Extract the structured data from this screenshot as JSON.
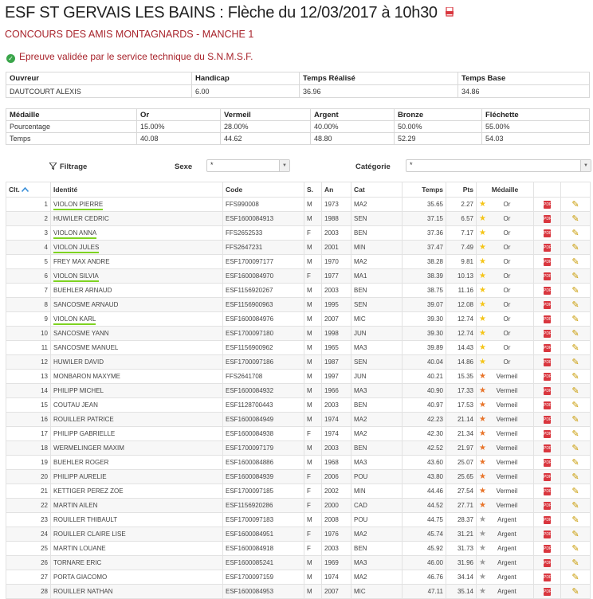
{
  "header": {
    "title": "ESF ST GERVAIS LES BAINS : Flèche du 12/03/2017 à 10h30",
    "subtitle": "CONCOURS DES AMIS MONTAGNARDS - MANCHE 1",
    "validation": "Epreuve validée par le service technique du S.N.M.S.F.",
    "check_icon": "check-circle-icon",
    "pdf_icon": "pdf-icon"
  },
  "info": {
    "headers": [
      "Ouvreur",
      "Handicap",
      "Temps Réalisé",
      "Temps Base"
    ],
    "values": [
      "DAUTCOURT ALEXIS",
      "6.00",
      "36.96",
      "34.86"
    ]
  },
  "medals": {
    "headers": [
      "Médaille",
      "Or",
      "Vermeil",
      "Argent",
      "Bronze",
      "Fléchette"
    ],
    "rows": [
      [
        "Pourcentage",
        "15.00%",
        "28.00%",
        "40.00%",
        "50.00%",
        "55.00%"
      ],
      [
        "Temps",
        "40.08",
        "44.62",
        "48.80",
        "52.29",
        "54.03"
      ]
    ]
  },
  "filter": {
    "label": "Filtrage",
    "sexe_label": "Sexe",
    "sexe_value": "*",
    "categorie_label": "Catégorie",
    "categorie_value": "*"
  },
  "columns": [
    "Clt.",
    "Identité",
    "Code",
    "S.",
    "An",
    "Cat",
    "Temps",
    "Pts",
    "Médaille"
  ],
  "colors": {
    "title_red": "#a8232b",
    "gold": "#f5c518",
    "orange": "#e8742a",
    "grey": "#9a9a9a",
    "underline": "#7ed321"
  },
  "rows": [
    {
      "rank": "1",
      "name": "VIOLON PIERRE",
      "code": "FFS990008",
      "sex": "M",
      "year": "1973",
      "cat": "MA2",
      "time": "35.65",
      "pts": "2.27",
      "medal": "Or",
      "hl": true
    },
    {
      "rank": "2",
      "name": "HUWILER CEDRIC",
      "code": "ESF1600084913",
      "sex": "M",
      "year": "1988",
      "cat": "SEN",
      "time": "37.15",
      "pts": "6.57",
      "medal": "Or",
      "hl": false
    },
    {
      "rank": "3",
      "name": "VIOLON ANNA",
      "code": "FFS2652533",
      "sex": "F",
      "year": "2003",
      "cat": "BEN",
      "time": "37.36",
      "pts": "7.17",
      "medal": "Or",
      "hl": true
    },
    {
      "rank": "4",
      "name": "VIOLON JULES",
      "code": "FFS2647231",
      "sex": "M",
      "year": "2001",
      "cat": "MIN",
      "time": "37.47",
      "pts": "7.49",
      "medal": "Or",
      "hl": true
    },
    {
      "rank": "5",
      "name": "FREY MAX ANDRE",
      "code": "ESF1700097177",
      "sex": "M",
      "year": "1970",
      "cat": "MA2",
      "time": "38.28",
      "pts": "9.81",
      "medal": "Or",
      "hl": false
    },
    {
      "rank": "6",
      "name": "VIOLON SILVIA",
      "code": "ESF1600084970",
      "sex": "F",
      "year": "1977",
      "cat": "MA1",
      "time": "38.39",
      "pts": "10.13",
      "medal": "Or",
      "hl": true
    },
    {
      "rank": "7",
      "name": "BUEHLER ARNAUD",
      "code": "ESF1156920267",
      "sex": "M",
      "year": "2003",
      "cat": "BEN",
      "time": "38.75",
      "pts": "11.16",
      "medal": "Or",
      "hl": false
    },
    {
      "rank": "8",
      "name": "SANCOSME ARNAUD",
      "code": "ESF1156900963",
      "sex": "M",
      "year": "1995",
      "cat": "SEN",
      "time": "39.07",
      "pts": "12.08",
      "medal": "Or",
      "hl": false
    },
    {
      "rank": "9",
      "name": "VIOLON KARL",
      "code": "ESF1600084976",
      "sex": "M",
      "year": "2007",
      "cat": "MIC",
      "time": "39.30",
      "pts": "12.74",
      "medal": "Or",
      "hl": true
    },
    {
      "rank": "10",
      "name": "SANCOSME YANN",
      "code": "ESF1700097180",
      "sex": "M",
      "year": "1998",
      "cat": "JUN",
      "time": "39.30",
      "pts": "12.74",
      "medal": "Or",
      "hl": false
    },
    {
      "rank": "11",
      "name": "SANCOSME MANUEL",
      "code": "ESF1156900962",
      "sex": "M",
      "year": "1965",
      "cat": "MA3",
      "time": "39.89",
      "pts": "14.43",
      "medal": "Or",
      "hl": false
    },
    {
      "rank": "12",
      "name": "HUWILER DAVID",
      "code": "ESF1700097186",
      "sex": "M",
      "year": "1987",
      "cat": "SEN",
      "time": "40.04",
      "pts": "14.86",
      "medal": "Or",
      "hl": false
    },
    {
      "rank": "13",
      "name": "MONBARON MAXYME",
      "code": "FFS2641708",
      "sex": "M",
      "year": "1997",
      "cat": "JUN",
      "time": "40.21",
      "pts": "15.35",
      "medal": "Vermeil",
      "hl": false
    },
    {
      "rank": "14",
      "name": "PHILIPP MICHEL",
      "code": "ESF1600084932",
      "sex": "M",
      "year": "1966",
      "cat": "MA3",
      "time": "40.90",
      "pts": "17.33",
      "medal": "Vermeil",
      "hl": false
    },
    {
      "rank": "15",
      "name": "COUTAU JEAN",
      "code": "ESF1128700443",
      "sex": "M",
      "year": "2003",
      "cat": "BEN",
      "time": "40.97",
      "pts": "17.53",
      "medal": "Vermeil",
      "hl": false
    },
    {
      "rank": "16",
      "name": "ROUILLER PATRICE",
      "code": "ESF1600084949",
      "sex": "M",
      "year": "1974",
      "cat": "MA2",
      "time": "42.23",
      "pts": "21.14",
      "medal": "Vermeil",
      "hl": false
    },
    {
      "rank": "17",
      "name": "PHILIPP GABRIELLE",
      "code": "ESF1600084938",
      "sex": "F",
      "year": "1974",
      "cat": "MA2",
      "time": "42.30",
      "pts": "21.34",
      "medal": "Vermeil",
      "hl": false
    },
    {
      "rank": "18",
      "name": "WERMELINGER MAXIM",
      "code": "ESF1700097179",
      "sex": "M",
      "year": "2003",
      "cat": "BEN",
      "time": "42.52",
      "pts": "21.97",
      "medal": "Vermeil",
      "hl": false
    },
    {
      "rank": "19",
      "name": "BUEHLER ROGER",
      "code": "ESF1600084886",
      "sex": "M",
      "year": "1968",
      "cat": "MA3",
      "time": "43.60",
      "pts": "25.07",
      "medal": "Vermeil",
      "hl": false
    },
    {
      "rank": "20",
      "name": "PHILIPP AURELIE",
      "code": "ESF1600084939",
      "sex": "F",
      "year": "2006",
      "cat": "POU",
      "time": "43.80",
      "pts": "25.65",
      "medal": "Vermeil",
      "hl": false
    },
    {
      "rank": "21",
      "name": "KETTIGER PEREZ ZOE",
      "code": "ESF1700097185",
      "sex": "F",
      "year": "2002",
      "cat": "MIN",
      "time": "44.46",
      "pts": "27.54",
      "medal": "Vermeil",
      "hl": false
    },
    {
      "rank": "22",
      "name": "MARTIN AILEN",
      "code": "ESF1156920286",
      "sex": "F",
      "year": "2000",
      "cat": "CAD",
      "time": "44.52",
      "pts": "27.71",
      "medal": "Vermeil",
      "hl": false
    },
    {
      "rank": "23",
      "name": "ROUILLER THIBAULT",
      "code": "ESF1700097183",
      "sex": "M",
      "year": "2008",
      "cat": "POU",
      "time": "44.75",
      "pts": "28.37",
      "medal": "Argent",
      "hl": false
    },
    {
      "rank": "24",
      "name": "ROUILLER CLAIRE LISE",
      "code": "ESF1600084951",
      "sex": "F",
      "year": "1976",
      "cat": "MA2",
      "time": "45.74",
      "pts": "31.21",
      "medal": "Argent",
      "hl": false
    },
    {
      "rank": "25",
      "name": "MARTIN LOUANE",
      "code": "ESF1600084918",
      "sex": "F",
      "year": "2003",
      "cat": "BEN",
      "time": "45.92",
      "pts": "31.73",
      "medal": "Argent",
      "hl": false
    },
    {
      "rank": "26",
      "name": "TORNARE ERIC",
      "code": "ESF1600085241",
      "sex": "M",
      "year": "1969",
      "cat": "MA3",
      "time": "46.00",
      "pts": "31.96",
      "medal": "Argent",
      "hl": false
    },
    {
      "rank": "27",
      "name": "PORTA GIACOMO",
      "code": "ESF1700097159",
      "sex": "M",
      "year": "1974",
      "cat": "MA2",
      "time": "46.76",
      "pts": "34.14",
      "medal": "Argent",
      "hl": false
    },
    {
      "rank": "28",
      "name": "ROUILLER NATHAN",
      "code": "ESF1600084953",
      "sex": "M",
      "year": "2007",
      "cat": "MIC",
      "time": "47.11",
      "pts": "35.14",
      "medal": "Argent",
      "hl": false
    }
  ]
}
